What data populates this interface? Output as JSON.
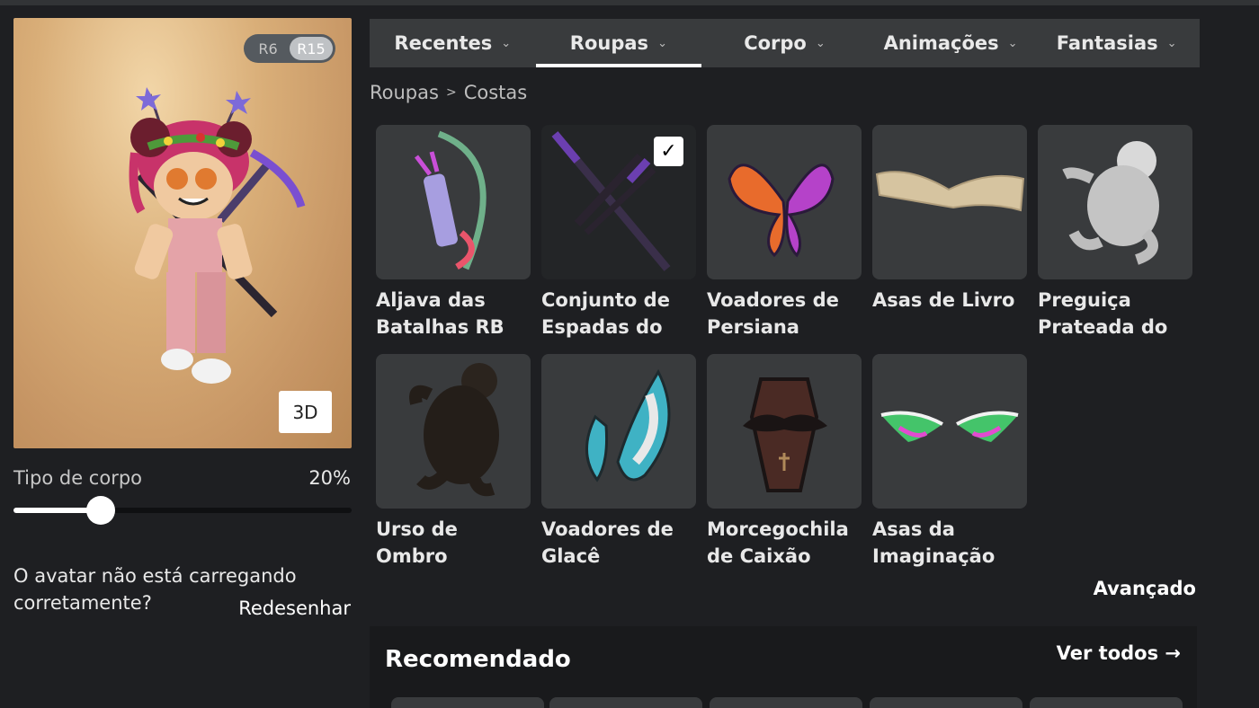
{
  "avatar": {
    "rig_options": [
      "R6",
      "R15"
    ],
    "rig_selected": "R15",
    "view_button": "3D",
    "body_type_label": "Tipo de corpo",
    "body_type_value": "20%",
    "body_type_fraction": 0.2,
    "issue_text": "O avatar não está carregando corretamente?",
    "redraw_label": "Redesenhar"
  },
  "tabs": [
    {
      "label": "Recentes",
      "active": false
    },
    {
      "label": "Roupas",
      "active": true
    },
    {
      "label": "Corpo",
      "active": false
    },
    {
      "label": "Animações",
      "active": false
    },
    {
      "label": "Fantasias",
      "active": false
    }
  ],
  "breadcrumb": {
    "parent": "Roupas",
    "current": "Costas"
  },
  "items": [
    {
      "name": "Aljava das Batalhas RB",
      "selected": false,
      "icon": "quiver-icon"
    },
    {
      "name": "Conjunto de Espadas do",
      "selected": true,
      "icon": "swords-icon"
    },
    {
      "name": "Voadores de Persiana",
      "selected": false,
      "icon": "butterfly-wings-icon"
    },
    {
      "name": "Asas de Livro",
      "selected": false,
      "icon": "paper-wings-icon"
    },
    {
      "name": "Preguiça Prateada do",
      "selected": false,
      "icon": "sloth-icon"
    },
    {
      "name": "Urso de Ombro",
      "selected": false,
      "icon": "bear-icon"
    },
    {
      "name": "Voadores de Glacê",
      "selected": false,
      "icon": "frosting-wings-icon"
    },
    {
      "name": "Morcegochila de Caixão",
      "selected": false,
      "icon": "coffin-bat-icon"
    },
    {
      "name": "Asas da Imaginação de",
      "selected": false,
      "icon": "rainbow-wings-icon"
    }
  ],
  "advanced_label": "Avançado",
  "recommended": {
    "title": "Recomendado",
    "see_all": "Ver todos →"
  },
  "colors": {
    "background": "#1e1f22",
    "panel": "#393b3d",
    "accent": "#ffffff"
  }
}
